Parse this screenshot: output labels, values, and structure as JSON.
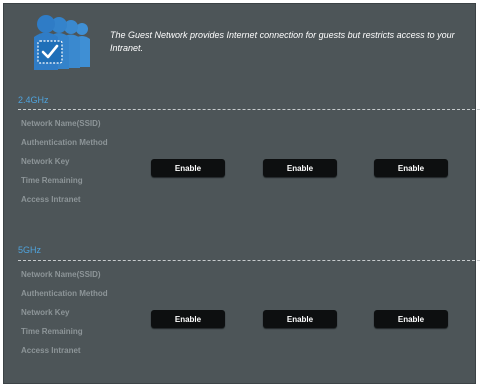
{
  "banner": {
    "icon": "guest-users-icon",
    "text": "The Guest Network provides Internet connection for guests but restricts access to your Intranet."
  },
  "sections": [
    {
      "band": "2.4GHz",
      "fields": [
        "Network Name(SSID)",
        "Authentication Method",
        "Network Key",
        "Time Remaining",
        "Access Intranet"
      ],
      "buttons": [
        "Enable",
        "Enable",
        "Enable"
      ]
    },
    {
      "band": "5GHz",
      "fields": [
        "Network Name(SSID)",
        "Authentication Method",
        "Network Key",
        "Time Remaining",
        "Access Intranet"
      ],
      "buttons": [
        "Enable",
        "Enable",
        "Enable"
      ]
    }
  ],
  "colors": {
    "panel_bg": "#4d5558",
    "band_label": "#4fa3dc",
    "field_label": "#8d9598",
    "button_bg": "#0d0f10",
    "icon_blue": "#2f82c9"
  }
}
